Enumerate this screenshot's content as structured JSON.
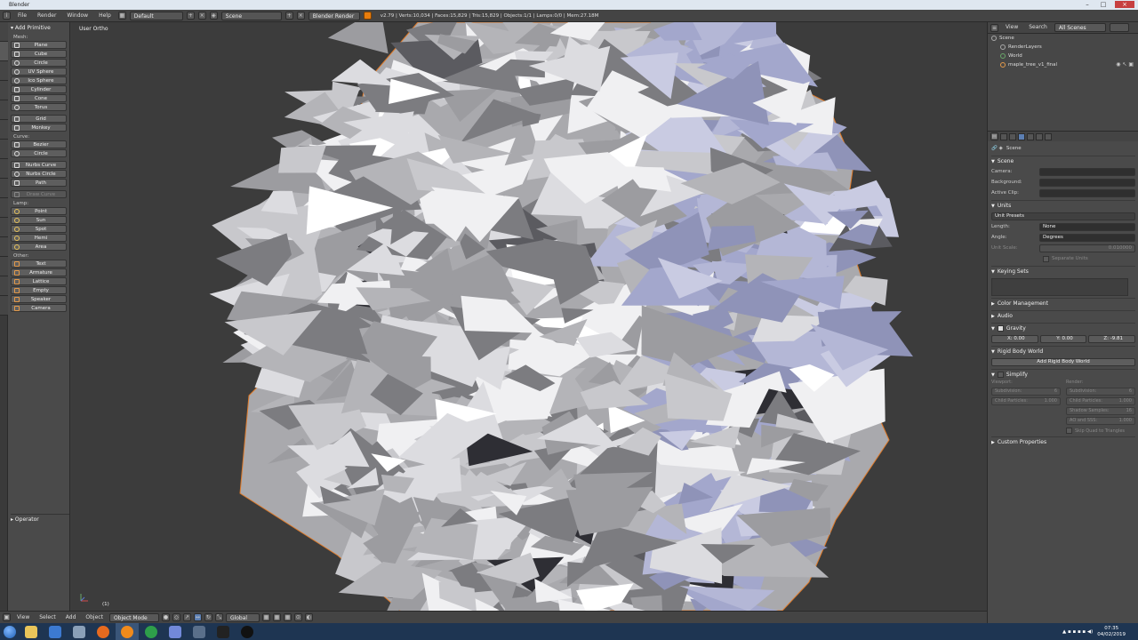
{
  "window": {
    "title": "Blender"
  },
  "infobar": {
    "menus": [
      "File",
      "Render",
      "Window",
      "Help"
    ],
    "layout": "Default",
    "scene": "Scene",
    "engine": "Blender Render",
    "stats": "v2.79 | Verts:10,034 | Faces:15,829 | Tris:15,829 | Objects:1/1 | Lamps:0/0 | Mem:27.18M"
  },
  "toolshelf": {
    "title": "Add Primitive",
    "groups": [
      {
        "label": "Mesh:",
        "items": [
          "Plane",
          "Cube",
          "Circle",
          "UV Sphere",
          "Ico Sphere",
          "Cylinder",
          "Cone",
          "Torus",
          "Grid",
          "Monkey"
        ]
      },
      {
        "label": "Curve:",
        "items": [
          "Bezier",
          "Circle",
          "Nurbs Curve",
          "Nurbs Circle",
          "Path",
          "Draw Curve"
        ]
      },
      {
        "label": "Lamp:",
        "items": [
          "Point",
          "Sun",
          "Spot",
          "Hemi",
          "Area"
        ]
      },
      {
        "label": "Other:",
        "items": [
          "Text",
          "Armature",
          "Lattice",
          "Empty",
          "Speaker",
          "Camera"
        ]
      }
    ],
    "operator": "Operator"
  },
  "viewport": {
    "label": "User Ortho",
    "frame": "(1)"
  },
  "vpheader": {
    "menus": [
      "View",
      "Select",
      "Add",
      "Object"
    ],
    "mode": "Object Mode",
    "orientation": "Global"
  },
  "outliner": {
    "menus": [
      "View",
      "Search"
    ],
    "filter": "All Scenes",
    "rows": [
      {
        "label": "Scene",
        "indent": 0
      },
      {
        "label": "RenderLayers",
        "indent": 1
      },
      {
        "label": "World",
        "indent": 1
      },
      {
        "label": "maple_tree_v1_final",
        "indent": 1
      }
    ]
  },
  "properties": {
    "context": "Scene",
    "scene_section": "Scene",
    "camera_label": "Camera:",
    "background_label": "Background:",
    "clip_label": "Active Clip:",
    "units_section": "Units",
    "unit_presets": "Unit Presets",
    "length_label": "Length:",
    "length_value": "None",
    "angle_label": "Angle:",
    "angle_value": "Degrees",
    "unit_scale_label": "Unit Scale:",
    "unit_scale_value": "0.010000",
    "separate_units": "Separate Units",
    "keying_sets": "Keying Sets",
    "color_mgmt": "Color Management",
    "audio": "Audio",
    "gravity": "Gravity",
    "gravity_x": "X: 0.00",
    "gravity_y": "Y: 0.00",
    "gravity_z": "Z: -9.81",
    "rigid_body": "Rigid Body World",
    "add_rigid": "Add Rigid Body World",
    "simplify": "Simplify",
    "viewport_label": "Viewport:",
    "render_label": "Render:",
    "simp_left": [
      {
        "k": "Subdivision:",
        "v": "6"
      },
      {
        "k": "Child Particles:",
        "v": "1.000"
      }
    ],
    "simp_right": [
      {
        "k": "Subdivision:",
        "v": "6"
      },
      {
        "k": "Child Particles:",
        "v": "1.000"
      },
      {
        "k": "Shadow Samples:",
        "v": "16"
      },
      {
        "k": "AO and SSS:",
        "v": "1.000"
      }
    ],
    "skip_quad": "Skip Quad to Triangles",
    "custom_props": "Custom Properties"
  },
  "taskbar": {
    "time": "07:35",
    "date": "04/02/2019"
  },
  "colors": {
    "selection_outline": "#e07b2a",
    "leaf_light": "#e8e8ee",
    "leaf_blue": "#b9bcd8"
  }
}
